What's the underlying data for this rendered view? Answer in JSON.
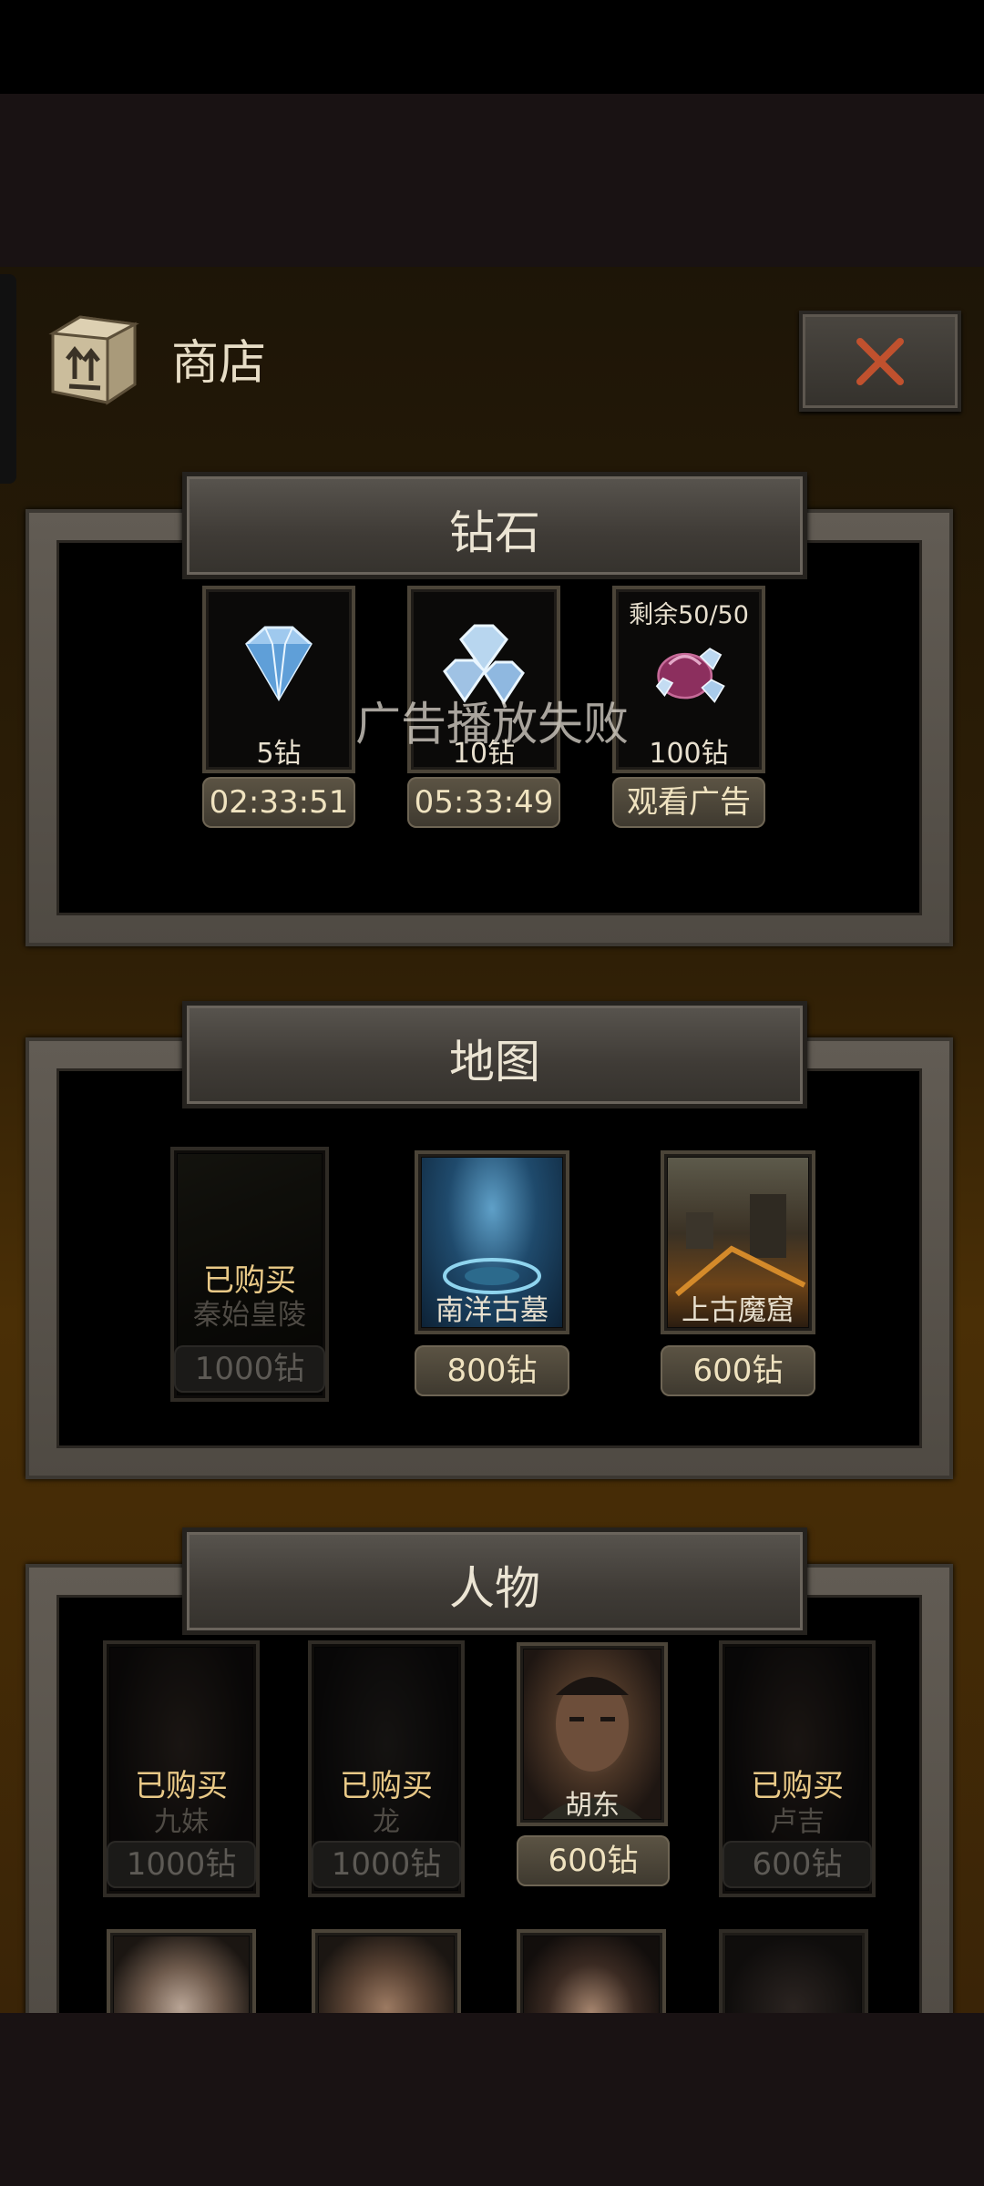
{
  "shop": {
    "title": "商店",
    "close_icon": "close-x-icon",
    "toast": "广告播放失败",
    "bought_label": "已购买"
  },
  "diamond_section": {
    "title": "钻石",
    "items": [
      {
        "label": "5钻",
        "action": "02:33:51",
        "icon": "diamond-icon"
      },
      {
        "label": "10钻",
        "action": "05:33:49",
        "icon": "diamonds-icon"
      },
      {
        "label": "100钻",
        "action": "观看广告",
        "remaining": "剩余50/50",
        "icon": "diamond-bag-icon"
      }
    ]
  },
  "map_section": {
    "title": "地图",
    "items": [
      {
        "name": "秦始皇陵",
        "price": "1000钻",
        "purchased": true
      },
      {
        "name": "南洋古墓",
        "price": "800钻",
        "purchased": false
      },
      {
        "name": "上古魔窟",
        "price": "600钻",
        "purchased": false
      }
    ]
  },
  "character_section": {
    "title": "人物",
    "items": [
      {
        "name": "九妹",
        "price": "1000钻",
        "purchased": true
      },
      {
        "name": "龙",
        "price": "1000钻",
        "purchased": true
      },
      {
        "name": "胡东",
        "price": "600钻",
        "purchased": false
      },
      {
        "name": "卢吉",
        "price": "600钻",
        "purchased": true
      }
    ]
  },
  "colors": {
    "accent_gold": "#e9c987",
    "close_red": "#c0512e",
    "panel_frame": "#5a544c"
  }
}
